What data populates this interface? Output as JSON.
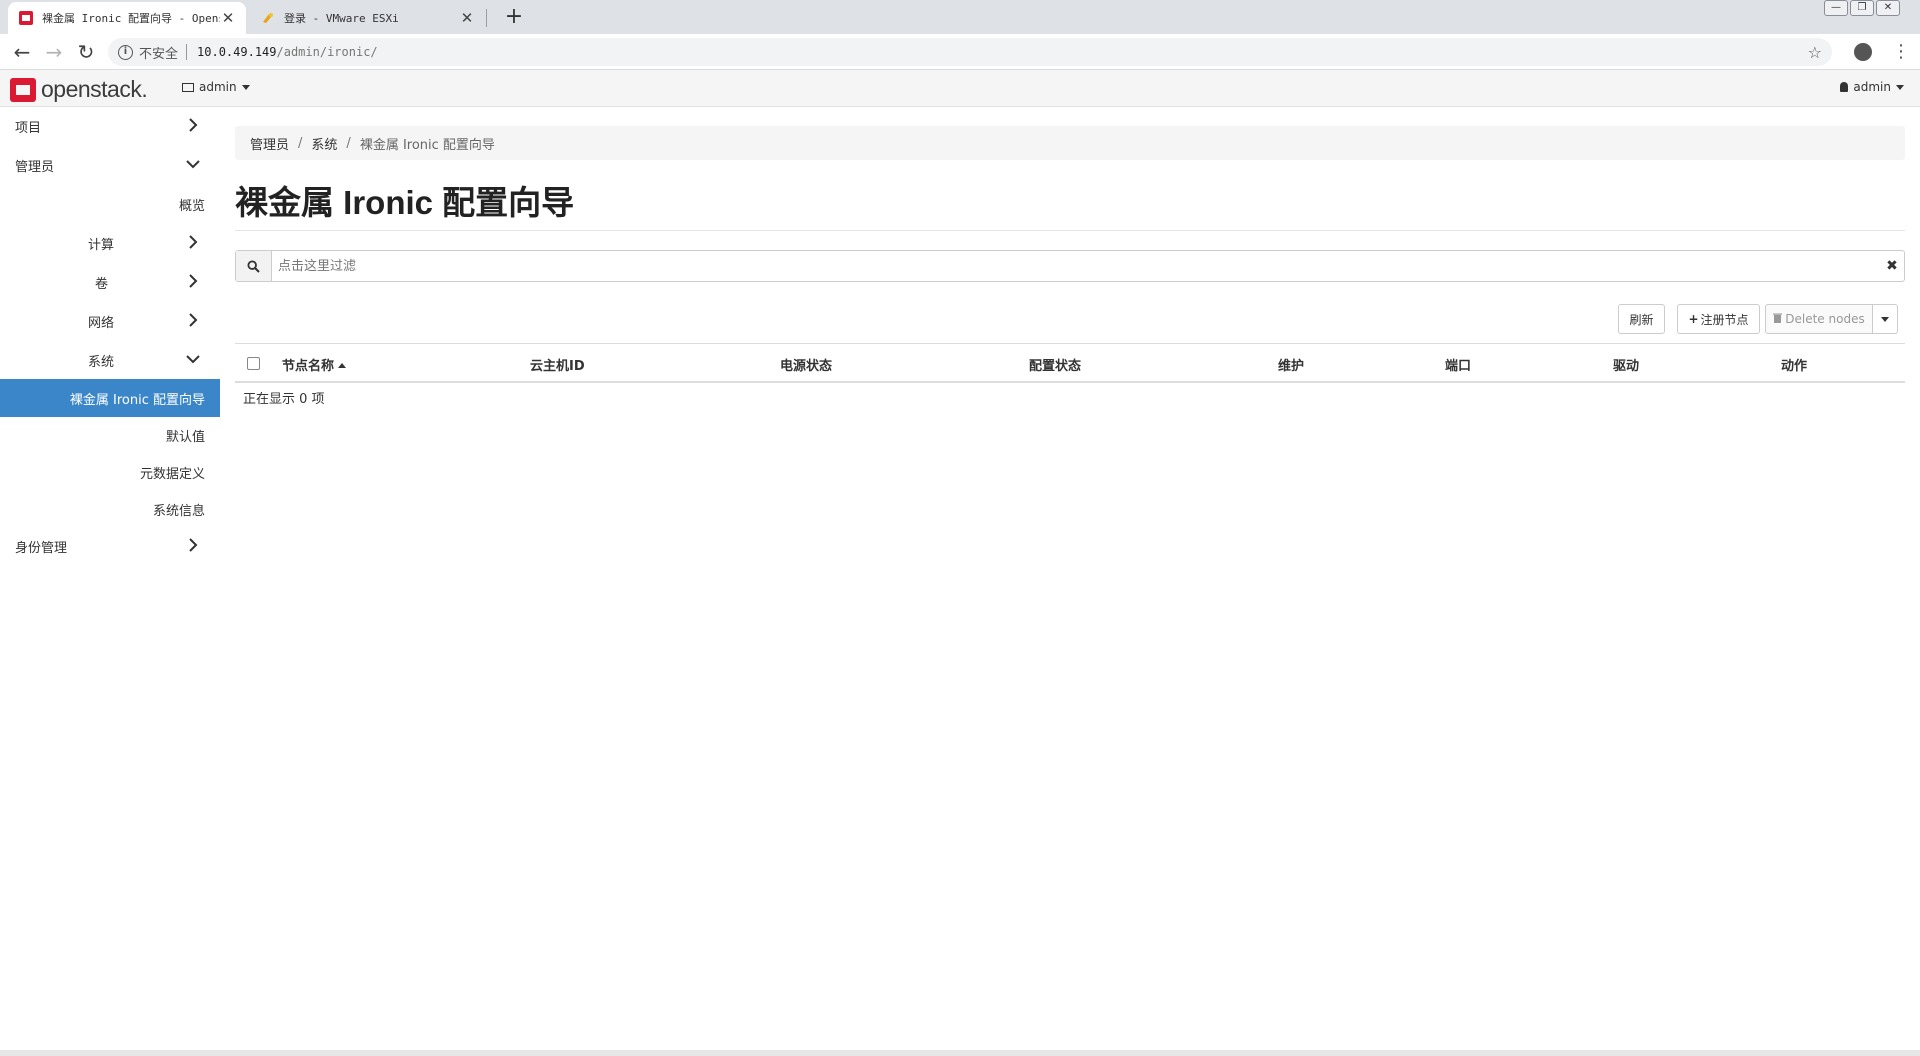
{
  "browser": {
    "tabs": [
      {
        "title": "裸金属 Ironic 配置向导 - Openstack",
        "active": true
      },
      {
        "title": "登录 - VMware ESXi",
        "active": false
      }
    ],
    "new_tab": "+",
    "address": {
      "security_label": "不安全",
      "host": "10.0.49.149",
      "path": "/admin/ironic/"
    }
  },
  "header": {
    "logo_text": "openstack.",
    "project": "admin",
    "user": "admin"
  },
  "sidebar": {
    "items": [
      {
        "label": "项目",
        "chevron": "right"
      },
      {
        "label": "管理员",
        "chevron": "down"
      },
      {
        "label": "概览"
      },
      {
        "label": "计算",
        "chevron": "right"
      },
      {
        "label": "卷",
        "chevron": "right"
      },
      {
        "label": "网络",
        "chevron": "right"
      },
      {
        "label": "系统",
        "chevron": "down"
      },
      {
        "label": "裸金属 Ironic 配置向导",
        "active": true
      },
      {
        "label": "默认值"
      },
      {
        "label": "元数据定义"
      },
      {
        "label": "系统信息"
      },
      {
        "label": "身份管理",
        "chevron": "right"
      }
    ]
  },
  "breadcrumb": {
    "items": [
      "管理员",
      "系统",
      "裸金属 Ironic 配置向导"
    ],
    "divider": "/"
  },
  "page": {
    "title": "裸金属 Ironic 配置向导"
  },
  "filter": {
    "placeholder": "点击这里过滤",
    "value": ""
  },
  "actions": {
    "refresh": "刷新",
    "register": "注册节点",
    "delete": "Delete nodes"
  },
  "table": {
    "columns": [
      "节点名称",
      "云主机ID",
      "电源状态",
      "配置状态",
      "维护",
      "端口",
      "驱动",
      "动作"
    ],
    "sorted_column": "节点名称",
    "rows": [],
    "footer": "正在显示 0 项"
  },
  "colors": {
    "accent": "#3b86c9",
    "brand": "#da1a32"
  }
}
